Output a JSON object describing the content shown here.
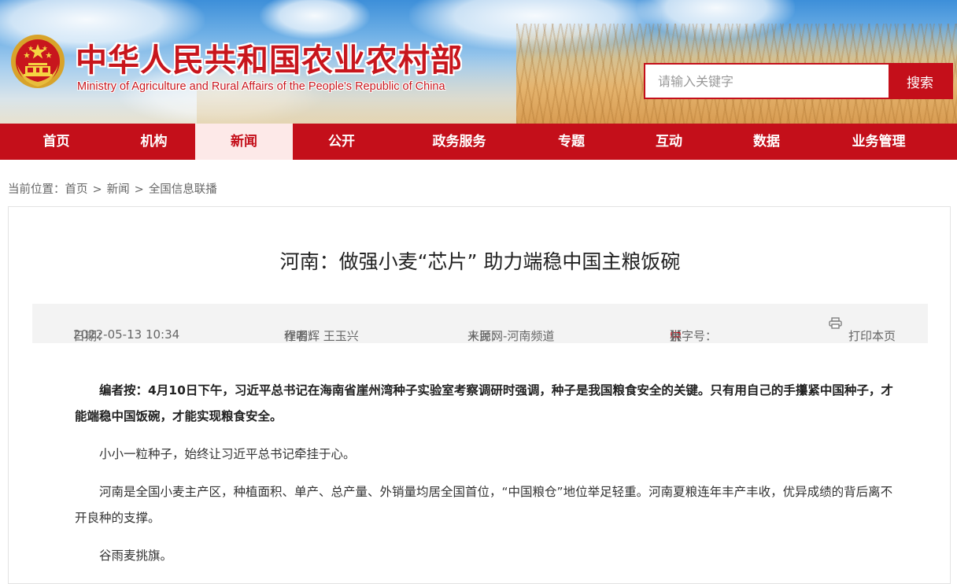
{
  "header": {
    "title_cn": "中华人民共和国农业农村部",
    "title_en": "Ministry of Agriculture and Rural Affairs of the People's Republic of China",
    "emblem_icon": "national-emblem-icon"
  },
  "search": {
    "placeholder": "请输入关键字",
    "button_label": "搜索"
  },
  "nav": {
    "items": [
      {
        "label": "首页",
        "active": false
      },
      {
        "label": "机构",
        "active": false
      },
      {
        "label": "新闻",
        "active": true
      },
      {
        "label": "公开",
        "active": false
      },
      {
        "label": "政务服务",
        "active": false
      },
      {
        "label": "专题",
        "active": false
      },
      {
        "label": "互动",
        "active": false
      },
      {
        "label": "数据",
        "active": false
      },
      {
        "label": "业务管理",
        "active": false
      }
    ]
  },
  "breadcrumb": {
    "prefix": "当前位置：",
    "items": [
      "首页",
      "新闻",
      "全国信息联播"
    ],
    "separator": ">"
  },
  "article": {
    "title": "河南：做强小麦“芯片” 助力端稳中国主粮饭碗",
    "meta": {
      "date_label": "日期：",
      "date": "2022-05-13 10:34",
      "author_label": "作者：",
      "author": "程明辉 王玉兴",
      "source_label": "来源：",
      "source": "人民网-河南频道",
      "font_size_open": "【字号：",
      "font_large": "大",
      "font_medium": "中",
      "font_small": "小",
      "font_size_close": "】",
      "print_label": "打印本页"
    },
    "paragraphs": [
      "编者按：4月10日下午，习近平总书记在海南省崖州湾种子实验室考察调研时强调，种子是我国粮食安全的关键。只有用自己的手攥紧中国种子，才能端稳中国饭碗，才能实现粮食安全。",
      "小小一粒种子，始终让习近平总书记牵挂于心。",
      "河南是全国小麦主产区，种植面积、单产、总产量、外销量均居全国首位，“中国粮仓”地位举足轻重。河南夏粮连年丰产丰收，优异成绩的背后离不开良种的支撑。",
      "谷雨麦挑旗。"
    ]
  },
  "colors": {
    "brand_red": "#c40f1a",
    "nav_active_bg": "#fde9e8",
    "meta_bg": "#f3f3f3"
  }
}
